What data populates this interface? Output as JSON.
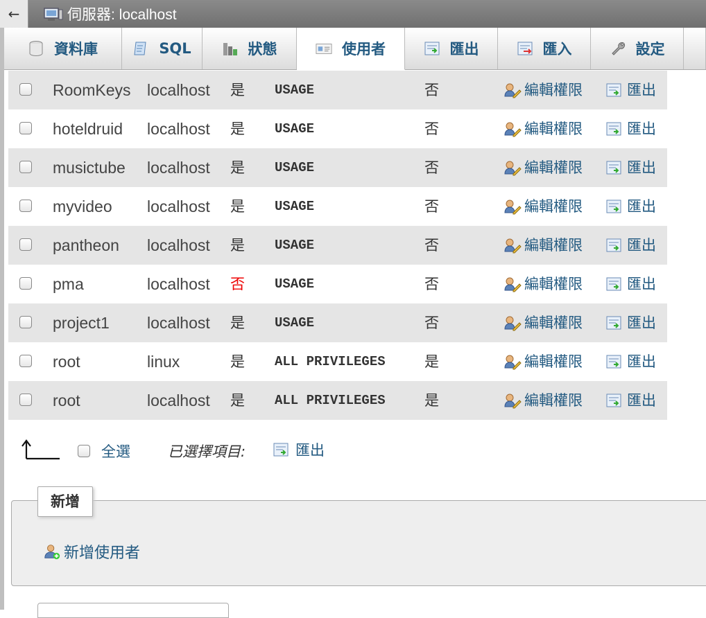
{
  "topbar": {
    "back_icon": "←",
    "server_label": "伺服器: localhost"
  },
  "tabs": [
    {
      "label": "資料庫",
      "icon": "database-icon"
    },
    {
      "label": "SQL",
      "icon": "sql-icon"
    },
    {
      "label": "狀態",
      "icon": "status-chart-icon"
    },
    {
      "label": "使用者",
      "icon": "users-card-icon",
      "active": true
    },
    {
      "label": "匯出",
      "icon": "export-icon"
    },
    {
      "label": "匯入",
      "icon": "import-icon"
    },
    {
      "label": "設定",
      "icon": "wrench-icon"
    }
  ],
  "users": [
    {
      "user": "RoomKeys",
      "host": "localhost",
      "password": "是",
      "privileges": "USAGE",
      "grant": "否",
      "edit": "編輯權限",
      "export": "匯出"
    },
    {
      "user": "hoteldruid",
      "host": "localhost",
      "password": "是",
      "privileges": "USAGE",
      "grant": "否",
      "edit": "編輯權限",
      "export": "匯出"
    },
    {
      "user": "musictube",
      "host": "localhost",
      "password": "是",
      "privileges": "USAGE",
      "grant": "否",
      "edit": "編輯權限",
      "export": "匯出"
    },
    {
      "user": "myvideo",
      "host": "localhost",
      "password": "是",
      "privileges": "USAGE",
      "grant": "否",
      "edit": "編輯權限",
      "export": "匯出"
    },
    {
      "user": "pantheon",
      "host": "localhost",
      "password": "是",
      "privileges": "USAGE",
      "grant": "否",
      "edit": "編輯權限",
      "export": "匯出"
    },
    {
      "user": "pma",
      "host": "localhost",
      "password": "否",
      "privileges": "USAGE",
      "grant": "否",
      "edit": "編輯權限",
      "export": "匯出"
    },
    {
      "user": "project1",
      "host": "localhost",
      "password": "是",
      "privileges": "USAGE",
      "grant": "否",
      "edit": "編輯權限",
      "export": "匯出"
    },
    {
      "user": "root",
      "host": "linux",
      "password": "是",
      "privileges": "ALL PRIVILEGES",
      "grant": "是",
      "edit": "編輯權限",
      "export": "匯出"
    },
    {
      "user": "root",
      "host": "localhost",
      "password": "是",
      "privileges": "ALL PRIVILEGES",
      "grant": "是",
      "edit": "編輯權限",
      "export": "匯出"
    }
  ],
  "actions": {
    "check_all": "全選",
    "with_selected": "已選擇項目:",
    "export": "匯出"
  },
  "new_section": {
    "legend": "新增",
    "add_user": "新增使用者"
  },
  "colors": {
    "link": "#235a81",
    "no_password": "#e00000",
    "row_alt": "#e5e5e5"
  }
}
